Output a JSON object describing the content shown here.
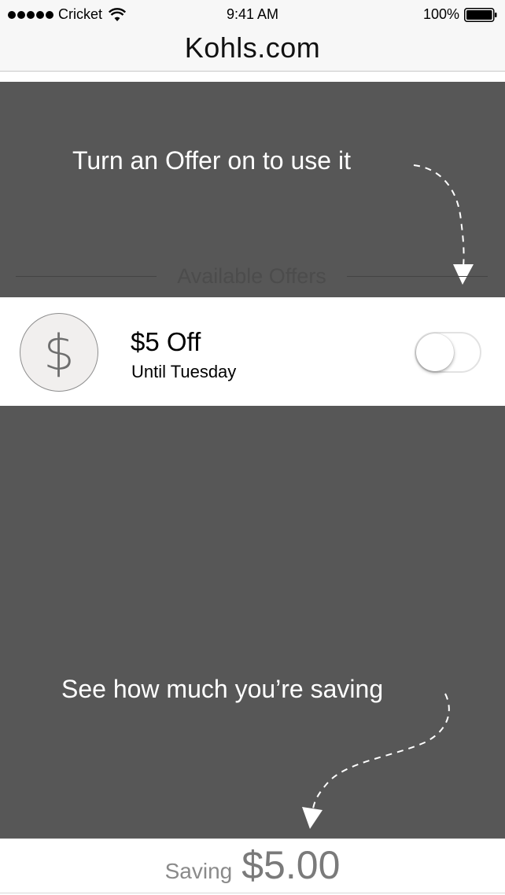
{
  "status_bar": {
    "carrier": "Cricket",
    "time": "9:41 AM",
    "battery_percent": "100%",
    "signal_icon": "signal-dots-icon",
    "wifi_icon": "wifi-icon",
    "battery_icon": "battery-icon"
  },
  "nav": {
    "title": "Kohls.com"
  },
  "hints": {
    "top": "Turn an Offer on to use it",
    "bottom": "See how much you’re saving"
  },
  "offers": {
    "section_label": "Available Offers",
    "items": [
      {
        "icon_glyph": "$",
        "icon": "dollar-icon",
        "title": "$5 Off",
        "subtitle": "Until Tuesday",
        "enabled": false
      }
    ]
  },
  "saving": {
    "label": "Saving",
    "amount": "$5.00"
  },
  "colors": {
    "overlay": "#575757",
    "toggle_border": "#e2e2e2",
    "hint_text": "#ffffff"
  }
}
